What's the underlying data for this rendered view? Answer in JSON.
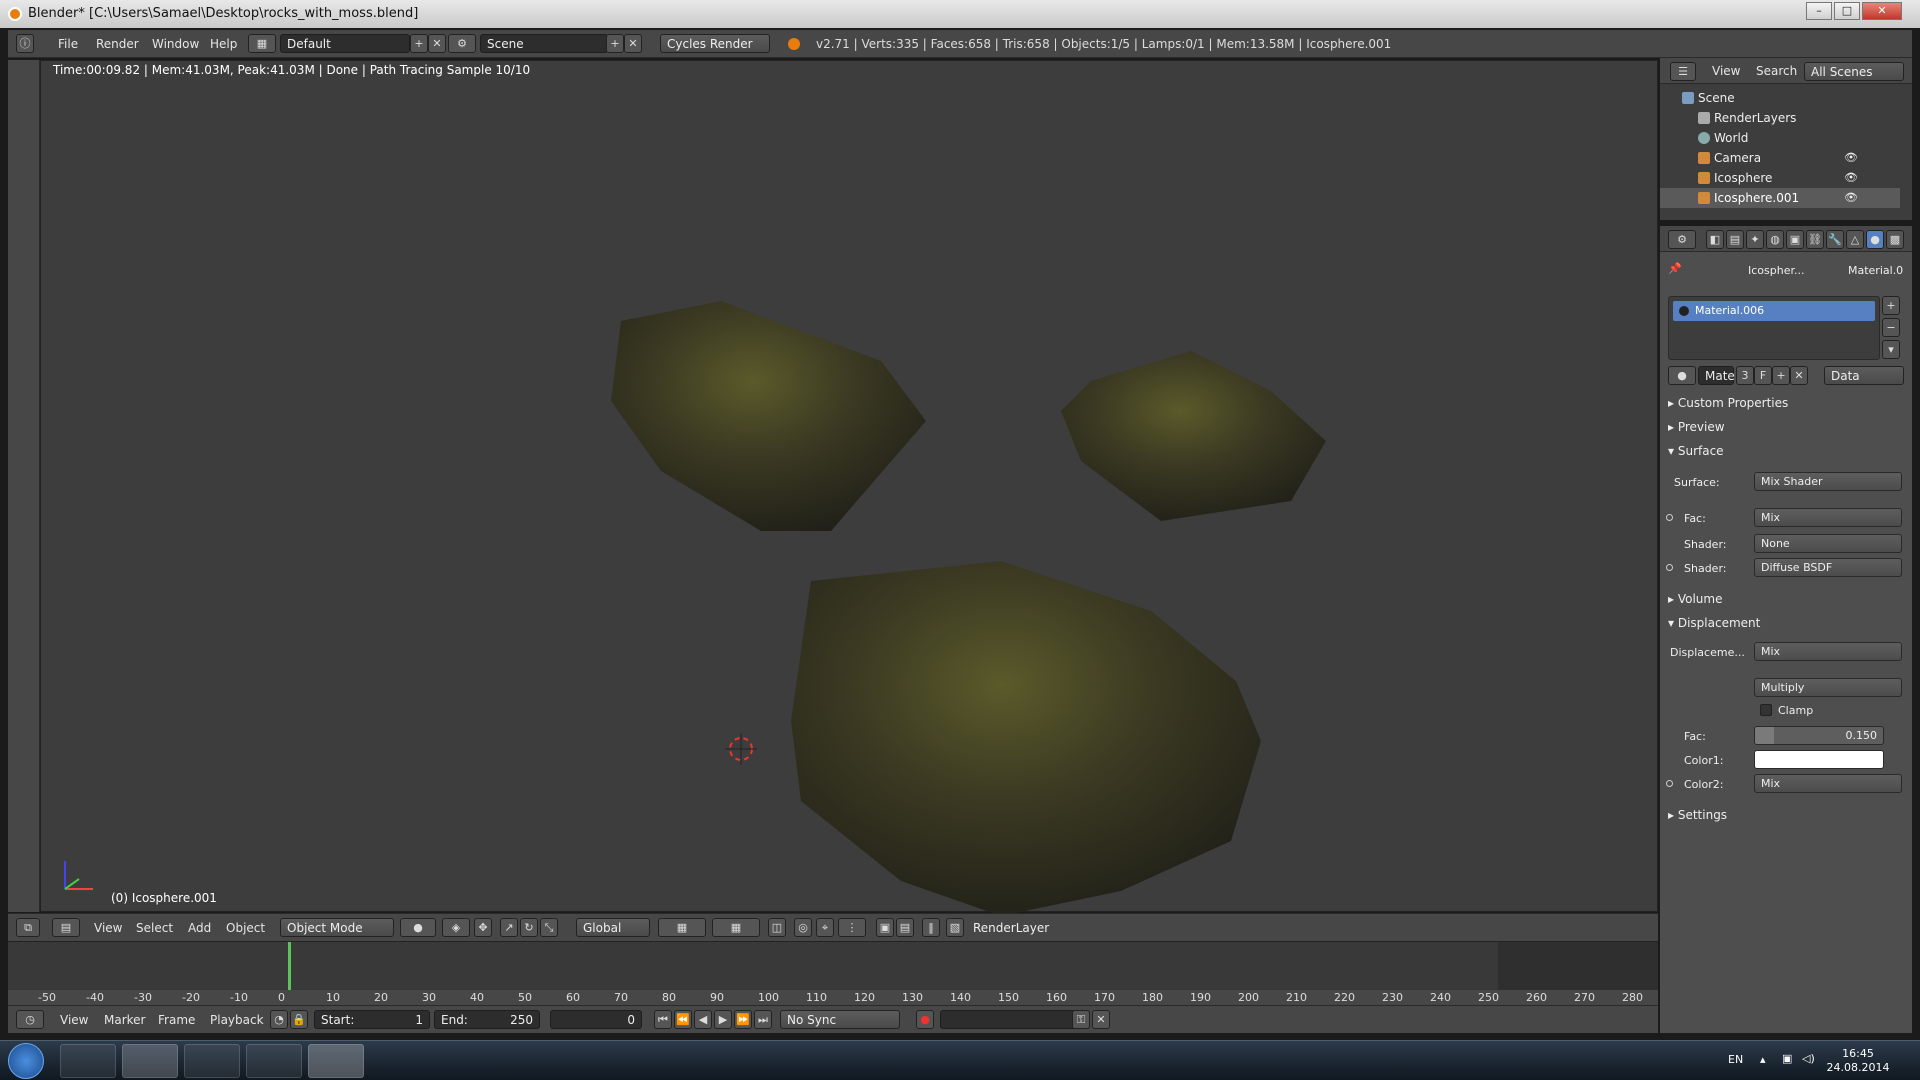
{
  "window": {
    "title": "Blender* [C:\\Users\\Samael\\Desktop\\rocks_with_moss.blend]",
    "min": "–",
    "max": "□",
    "close": "✕"
  },
  "menu": {
    "file": "File",
    "render": "Render",
    "window": "Window",
    "help": "Help"
  },
  "layout": {
    "value": "Default"
  },
  "scene": {
    "value": "Scene"
  },
  "engine": {
    "value": "Cycles Render"
  },
  "stats": "v2.71 | Verts:335 | Faces:658 | Tris:658 | Objects:1/5 | Lamps:0/1 | Mem:13.58M | Icosphere.001",
  "viewport": {
    "render_info": "Time:00:09.82 | Mem:41.03M, Peak:41.03M | Done | Path Tracing Sample 10/10",
    "object_label": "(0) Icosphere.001"
  },
  "vp_header": {
    "view": "View",
    "select": "Select",
    "add": "Add",
    "object": "Object",
    "mode": "Object Mode",
    "orientation": "Global",
    "render_layer": "RenderLayer"
  },
  "timeline": {
    "ticks": [
      "-50",
      "-40",
      "-30",
      "-20",
      "-10",
      "0",
      "10",
      "20",
      "30",
      "40",
      "50",
      "60",
      "70",
      "80",
      "90",
      "100",
      "110",
      "120",
      "130",
      "140",
      "150",
      "160",
      "170",
      "180",
      "190",
      "200",
      "210",
      "220",
      "230",
      "240",
      "250",
      "260",
      "270",
      "280"
    ],
    "view": "View",
    "marker": "Marker",
    "frame": "Frame",
    "playback": "Playback",
    "start_label": "Start:",
    "start": "1",
    "end_label": "End:",
    "end": "250",
    "current": "0",
    "sync": "No Sync"
  },
  "outliner": {
    "view": "View",
    "search": "Search",
    "filter": "All Scenes",
    "items": [
      {
        "label": "Scene"
      },
      {
        "label": "RenderLayers"
      },
      {
        "label": "World"
      },
      {
        "label": "Camera"
      },
      {
        "label": "Icosphere"
      },
      {
        "label": "Icosphere.001"
      }
    ]
  },
  "props": {
    "breadcrumb_obj": "Icospher...",
    "breadcrumb_mat": "Material.0",
    "slot": "Material.006",
    "mat_short": "Mate",
    "users": "3",
    "fake": "F",
    "link": "Data",
    "sections": {
      "custom": "Custom Properties",
      "preview": "Preview",
      "surface": "Surface",
      "volume": "Volume",
      "displacement": "Displacement",
      "settings": "Settings"
    },
    "surface": {
      "surface_label": "Surface:",
      "surface_val": "Mix Shader",
      "fac_label": "Fac:",
      "fac_val": "Mix",
      "shader1_label": "Shader:",
      "shader1_val": "None",
      "shader2_label": "Shader:",
      "shader2_val": "Diffuse BSDF"
    },
    "displacement": {
      "disp_label": "Displaceme...",
      "disp_val": "Mix",
      "blend": "Multiply",
      "clamp": "Clamp",
      "fac_label": "Fac:",
      "fac_val": "0.150",
      "color1_label": "Color1:",
      "color2_label": "Color2:",
      "color2_val": "Mix"
    }
  },
  "taskbar": {
    "lang": "EN",
    "time": "16:45",
    "date": "24.08.2014"
  }
}
